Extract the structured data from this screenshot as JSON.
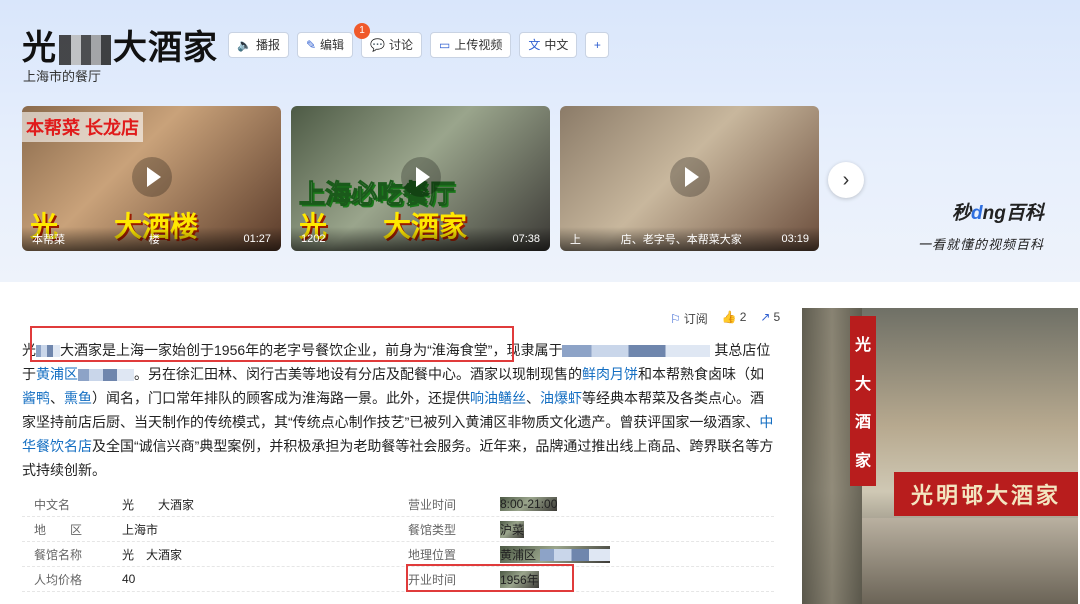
{
  "header": {
    "title_prefix": "光",
    "title_suffix": "大酒家",
    "subtitle": "上海市的餐厅",
    "tools": [
      {
        "label": "播报",
        "icon": "speaker-icon"
      },
      {
        "label": "编辑",
        "icon": "pencil-icon"
      },
      {
        "label": "讨论",
        "icon": "chat-icon",
        "badge": "1"
      },
      {
        "label": "上传视频",
        "icon": "video-icon"
      },
      {
        "label": "中文",
        "icon": "translate-icon"
      },
      {
        "label": "+",
        "icon": "plus-icon"
      }
    ]
  },
  "videos": [
    {
      "tag": "本帮菜 长龙店",
      "big": "光　　大酒楼",
      "caption_left": "本帮菜",
      "caption_mid": "楼",
      "duration": "01:27"
    },
    {
      "tag2": "上海必吃餐厅",
      "big": "光　　大酒家",
      "caption_left": "1202",
      "duration": "07:38"
    },
    {
      "caption_left": "上",
      "caption_mid": "店、老字号、本帮菜大家",
      "duration": "03:19"
    }
  ],
  "brand": {
    "name_a": "秒",
    "name_o": "d",
    "name_b": "ng百科",
    "slogan": "一看就懂的视频百科"
  },
  "actions": [
    {
      "label": "订阅",
      "icon": "subscribe-icon"
    },
    {
      "label": "2",
      "icon": "like-icon"
    },
    {
      "label": "5",
      "icon": "share-icon"
    }
  ],
  "intro": {
    "p1": "光",
    "p2": "大酒家是上海一家始创于1956年的老字号餐饮企业，前身为“淮海食堂”",
    "p3": "，现隶属于",
    "p4": "其总店位于",
    "link_huangpu": "黄浦区",
    "p5": "。另在徐汇田林、闵行古美等地设有分店及配餐中心。酒家以现制现售的",
    "link_pie": "鲜肉月饼",
    "p6": "和本帮熟食卤味（如",
    "link_duck": "酱鸭",
    "p7": "、",
    "link_fish": "熏鱼",
    "p8": "）闻名，门口常年排队的顾客成为淮海路一景。此外，还提供",
    "link_eel": "响油鳝丝",
    "p9": "、",
    "link_shrimp": "油爆虾",
    "p10": "等经典本帮菜及各类点心。酒家坚持前店后厨、当天制作的传统模式，其“传统点心制作技艺”已被列入黄浦区非物质文化遗产。曾获评国家一级酒家、",
    "link_brand": "中华餐饮名店",
    "p11": "及全国“诚信兴商”典型案例，并积极承担为老助餐等社会服务。近年来，品牌通过推出线上商品、跨界联名等方式持续创新。"
  },
  "info": [
    {
      "k": "中文名",
      "v": "光　　大酒家",
      "k2": "营业时间",
      "v2": "8:00-21:00"
    },
    {
      "k": "地　　区",
      "v": "上海市",
      "k2": "餐馆类型",
      "v2": "沪菜"
    },
    {
      "k": "餐馆名称",
      "v": "光　大酒家",
      "k2": "地理位置",
      "v2": "黄浦区"
    },
    {
      "k": "人均价格",
      "v": "40",
      "k2": "开业时间",
      "v2": "1956年"
    }
  ],
  "photo": {
    "vertical_sign": [
      "光",
      "",
      "大",
      "酒",
      "家"
    ],
    "horizontal_sign": "光明邨大酒家"
  },
  "colors": {
    "accent": "#2f5fd1",
    "link": "#136ec2",
    "highlight": "#e03b3b"
  }
}
